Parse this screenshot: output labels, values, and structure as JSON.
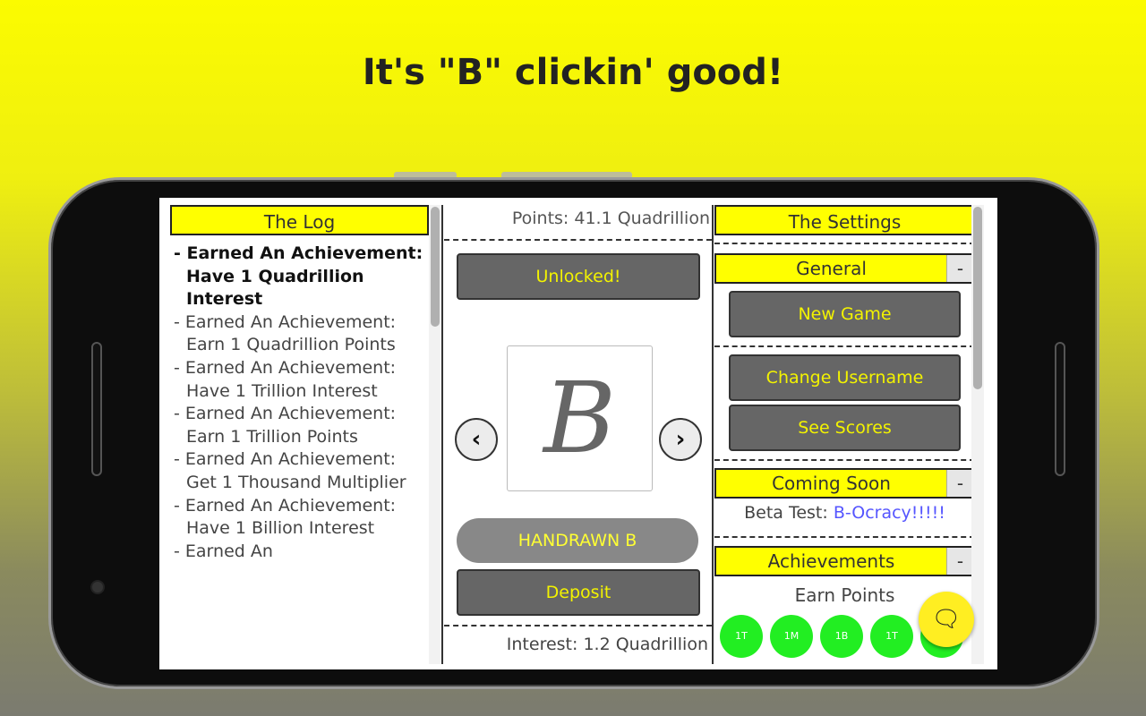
{
  "headline": "It's \"B\" clickin' good!",
  "log": {
    "title": "The Log",
    "entries": [
      "- Earned An Achievement: Have 1 Quadrillion Interest",
      "- Earned An Achievement: Earn 1 Quadrillion Points",
      "- Earned An Achievement: Have 1 Trillion Interest",
      "- Earned An Achievement: Earn 1 Trillion Points",
      "- Earned An Achievement: Get 1 Thousand Multiplier",
      "- Earned An Achievement: Have 1 Billion Interest",
      "- Earned An"
    ]
  },
  "center": {
    "points": "Points: 41.1 Quadrillion",
    "unlocked_label": "Unlocked!",
    "card_glyph": "B",
    "prev_icon": "chevron-left-icon",
    "next_icon": "chevron-right-icon",
    "skin_name": "HANDRAWN B",
    "deposit_label": "Deposit",
    "interest": "Interest: 1.2 Quadrillion"
  },
  "settings": {
    "title": "The Settings",
    "general": {
      "title": "General",
      "collapse": "-"
    },
    "new_game": "New Game",
    "change_username": "Change Username",
    "see_scores": "See Scores",
    "coming_soon": {
      "title": "Coming Soon",
      "collapse": "-"
    },
    "beta_prefix": "Beta Test: ",
    "beta_link": "B-Ocracy!!!!!",
    "achievements": {
      "title": "Achievements",
      "collapse": "-"
    },
    "earn_points": "Earn Points",
    "badges": [
      "1T",
      "1M",
      "1B",
      "1T",
      ""
    ]
  },
  "fab_icon": "chat-icon",
  "colors": {
    "accent": "#ffff00",
    "button": "#666666",
    "button_text": "#f3f300",
    "badge": "#22ee22",
    "link": "#5555ff"
  }
}
